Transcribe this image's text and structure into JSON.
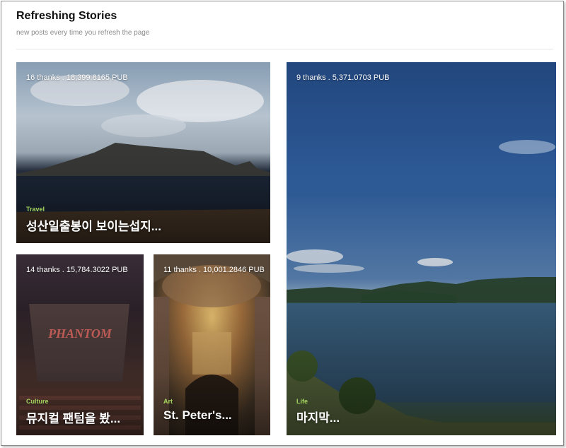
{
  "header": {
    "title": "Refreshing Stories",
    "subtitle": "new posts every time you refresh the page"
  },
  "cards": [
    {
      "meta": "16 thanks . 18,399.8165 PUB",
      "category": "Travel",
      "title": "성산일출봉이 보이는섭지...",
      "category_color": "#a4d65e"
    },
    {
      "meta": "9 thanks . 5,371.0703 PUB",
      "category": "Life",
      "title": "마지막...",
      "category_color": "#a4d65e"
    },
    {
      "meta": "14 thanks . 15,784.3022 PUB",
      "category": "Culture",
      "title": "뮤지컬 팬텀을 봤...",
      "category_color": "#a4d65e"
    },
    {
      "meta": "11 thanks . 10,001.2846 PUB",
      "category": "Art",
      "title": "St. Peter's...",
      "category_color": "#a4d65e"
    }
  ]
}
